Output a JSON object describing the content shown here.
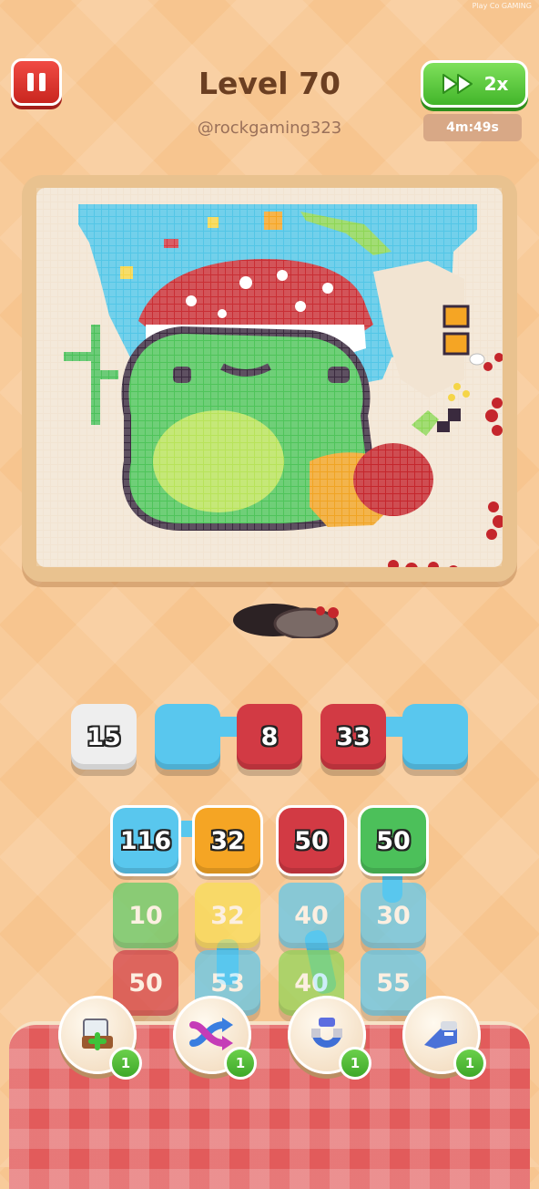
{
  "header": {
    "level_title": "Level 70",
    "username": "@rockgaming323",
    "speed_label": "2x",
    "timer": "4m:49s",
    "tiny_text": "Play Co GAMING"
  },
  "queue": [
    {
      "value": "15",
      "color": "#eeeeee"
    },
    {
      "value": "",
      "color": "#59c7ee"
    },
    {
      "value": "8",
      "color": "#d23a44"
    },
    {
      "value": "33",
      "color": "#d23a44"
    },
    {
      "value": "",
      "color": "#59c7ee"
    }
  ],
  "grid": [
    [
      {
        "value": "116",
        "color": "#59c7ee"
      },
      {
        "value": "32",
        "color": "#f5a524"
      },
      {
        "value": "50",
        "color": "#d23a44"
      },
      {
        "value": "50",
        "color": "#4cc05a"
      }
    ],
    [
      {
        "value": "10",
        "color": "#5ccb66"
      },
      {
        "value": "32",
        "color": "#f9df54"
      },
      {
        "value": "40",
        "color": "#59c7ee"
      },
      {
        "value": "30",
        "color": "#59c7ee"
      }
    ],
    [
      {
        "value": "50",
        "color": "#d23a44"
      },
      {
        "value": "53",
        "color": "#59c7ee"
      },
      {
        "value": "40",
        "color": "#8ed656"
      },
      {
        "value": "55",
        "color": "#59c7ee"
      }
    ]
  ],
  "powerups": [
    {
      "name": "add-slot",
      "count": "1"
    },
    {
      "name": "shuffle",
      "count": "1"
    },
    {
      "name": "magnet",
      "count": "1"
    },
    {
      "name": "vacuum",
      "count": "1"
    }
  ],
  "colors": {
    "accent_green": "#42b52a",
    "pause_red": "#d8322b",
    "title_brown": "#6b3f22"
  }
}
